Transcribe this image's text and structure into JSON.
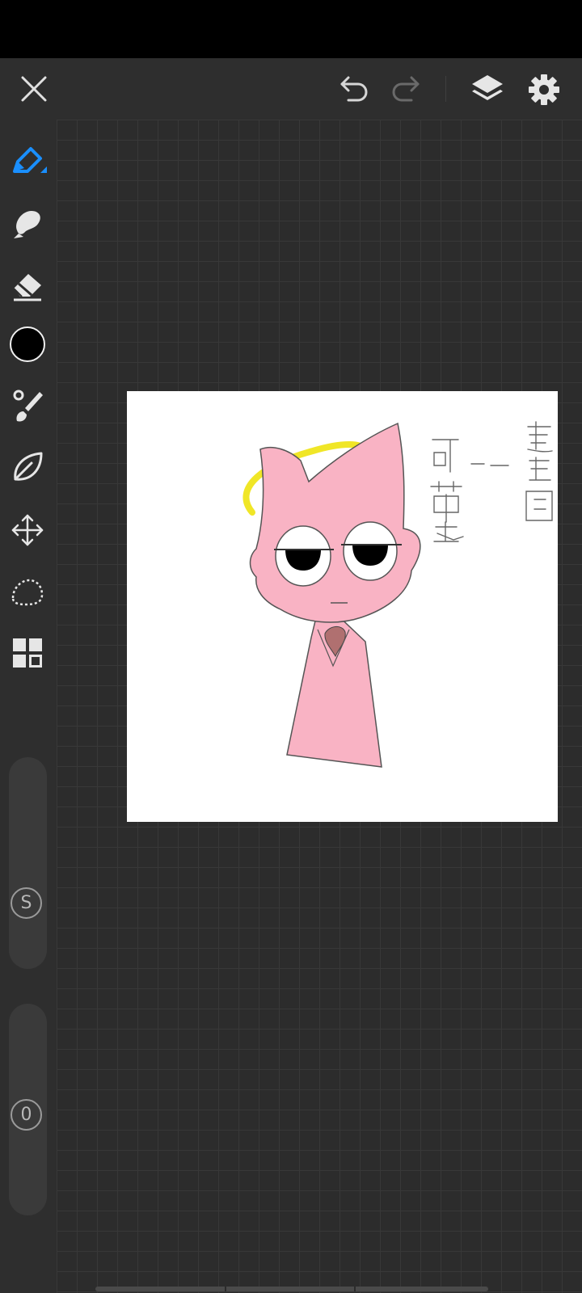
{
  "app": {
    "top_bar": {
      "close_icon": "close-icon",
      "undo_icon": "undo-icon",
      "redo_icon": "redo-icon",
      "layers_icon": "layers-icon",
      "settings_icon": "gear-icon"
    },
    "toolbar": {
      "tools": [
        {
          "name": "pencil",
          "icon": "pencil-icon",
          "active": true
        },
        {
          "name": "smudge",
          "icon": "smudge-icon"
        },
        {
          "name": "eraser",
          "icon": "eraser-icon"
        },
        {
          "name": "color",
          "icon": "color-swatch",
          "color": "#000000"
        },
        {
          "name": "brush",
          "icon": "brush-icon"
        },
        {
          "name": "shape",
          "icon": "leaf-icon"
        },
        {
          "name": "transform",
          "icon": "move-arrows-icon"
        },
        {
          "name": "lasso",
          "icon": "lasso-icon"
        },
        {
          "name": "gallery",
          "icon": "grid-icon"
        }
      ],
      "size_slider": {
        "label": "S"
      },
      "opacity_slider": {
        "label": "0"
      }
    },
    "canvas": {
      "handwritten_text": [
        "可帶走",
        "——",
        "壽喜配"
      ],
      "colors": {
        "body": "#f9b3c4",
        "halo": "#f0e627",
        "outline": "#555555"
      }
    },
    "accent_color": "#1a8fff"
  }
}
